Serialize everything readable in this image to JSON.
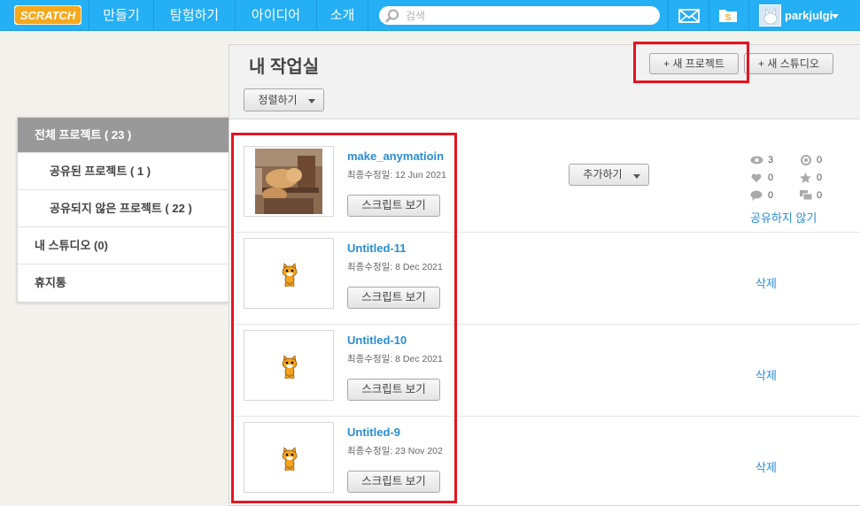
{
  "nav": {
    "logo_text": "SCRATCH",
    "items": [
      "만들기",
      "탐험하기",
      "아이디어",
      "소개"
    ],
    "search_placeholder": "검색",
    "username": "parkjulgi",
    "icons": {
      "search": "search-icon",
      "messages": "mail-icon",
      "my_stuff": "folder-icon",
      "account": "chevron-down-icon"
    }
  },
  "colors": {
    "nav_bg": "#25aff4",
    "link": "#2a8dd4",
    "highlight": "#e5141f",
    "sidebar_active": "#999999"
  },
  "sidebar": {
    "items": [
      {
        "label": "전체 프로젝트 ( 23 )",
        "active": true
      },
      {
        "label": "공유된 프로젝트 ( 1 )",
        "active": false
      },
      {
        "label": "공유되지 않은 프로젝트 ( 22 )",
        "active": false
      },
      {
        "label": "내 스튜디오 (0)",
        "active": false
      },
      {
        "label": "휴지통",
        "active": false
      }
    ]
  },
  "main": {
    "title": "내 작업실",
    "new_project": "+ 새 프로젝트",
    "new_studio": "+ 새 스튜디오",
    "sort": "정렬하기"
  },
  "projects": [
    {
      "title": "make_anymatioin",
      "modified": "최종수정일: 12 Jun 2021",
      "see_inside": "스크립트 보기",
      "add_to": "추가하기",
      "stats": {
        "views": "3",
        "remixes": "0",
        "loves": "0",
        "favorites": "0",
        "comments": "0",
        "studios": "0"
      },
      "action": "공유하지 않기"
    },
    {
      "title": "Untitled-11",
      "modified": "최종수정일: 8 Dec 2021",
      "see_inside": "스크립트 보기",
      "action": "삭제"
    },
    {
      "title": "Untitled-10",
      "modified": "최종수정일: 8 Dec 2021",
      "see_inside": "스크립트 보기",
      "action": "삭제"
    },
    {
      "title": "Untitled-9",
      "modified": "최종수정일: 23 Nov 202",
      "see_inside": "스크립트 보기",
      "action": "삭제"
    }
  ]
}
